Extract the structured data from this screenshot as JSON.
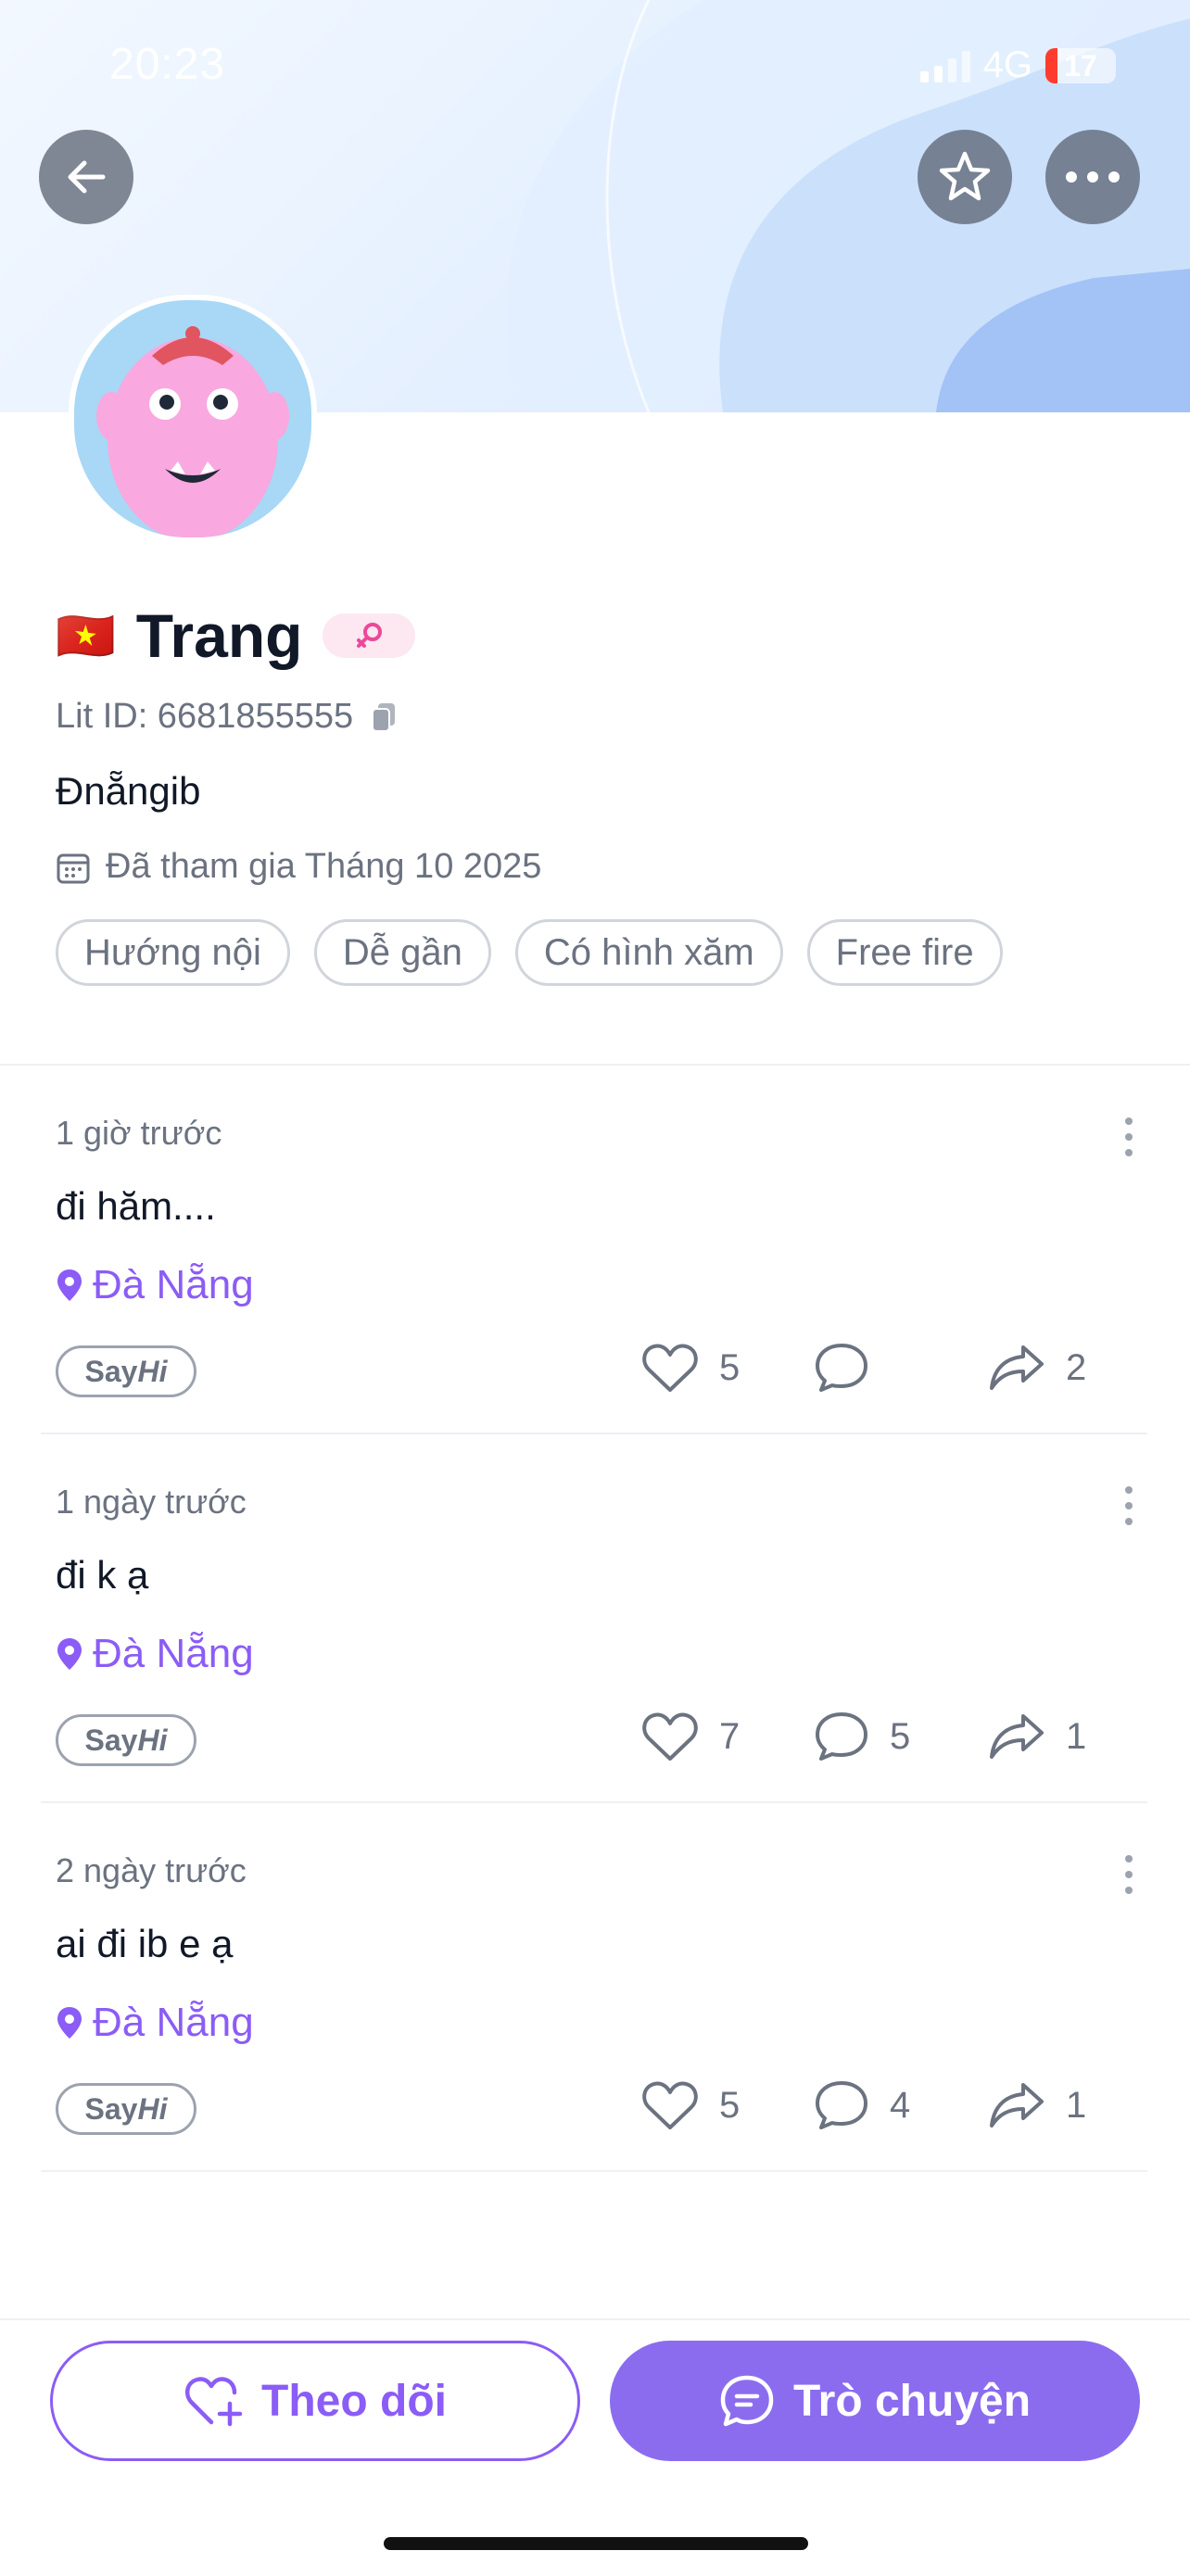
{
  "status_bar": {
    "time": "20:23",
    "network": "4G",
    "battery": "17",
    "battery_level": 0.17
  },
  "header": {
    "back_icon": "arrow-left-icon",
    "star_icon": "star-icon",
    "more_icon": "more-horizontal-icon"
  },
  "profile": {
    "flag": "🇻🇳",
    "name": "Trang",
    "gender_icon": "female-icon",
    "lit_id": "Lit ID: 6681855555",
    "bio": "Đnẵngib",
    "joined": "Đã tham gia Tháng 10 2025",
    "tags": [
      "Hướng nội",
      "Dễ gần",
      "Có hình xăm",
      "Free fire"
    ]
  },
  "posts": [
    {
      "time": "1 giờ trước",
      "text": "đi hăm....",
      "location": "Đà Nẵng",
      "likes": "5",
      "comments": "",
      "shares": "2"
    },
    {
      "time": "1 ngày trước",
      "text": "đi k ạ",
      "location": "Đà Nẵng",
      "likes": "7",
      "comments": "5",
      "shares": "1"
    },
    {
      "time": "2 ngày trước",
      "text": "ai đi ib e ạ",
      "location": "Đà Nẵng",
      "likes": "5",
      "comments": "4",
      "shares": "1"
    }
  ],
  "sayhi": {
    "say": "Say",
    "hi": "Hi"
  },
  "actions": {
    "follow_label": "Theo dõi",
    "chat_label": "Trò chuyện"
  },
  "colors": {
    "accent": "#8b5cf6",
    "chat_button": "#8b6cef",
    "battery_low": "#ff3b30"
  }
}
